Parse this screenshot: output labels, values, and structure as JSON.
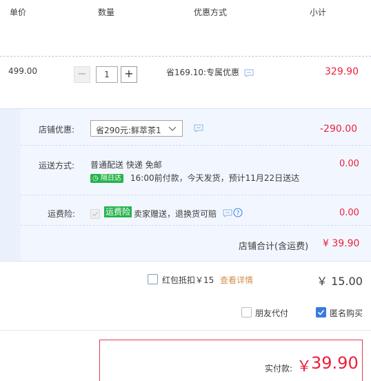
{
  "header": {
    "col_price": "单价",
    "col_qty": "数量",
    "col_promo": "优惠方式",
    "col_subtotal": "小计"
  },
  "item": {
    "price": "499.00",
    "minus": "−",
    "quantity": "1",
    "plus": "+",
    "promo": "省169.10:专属优惠",
    "subtotal": "329.90"
  },
  "shop_discount": {
    "label": "店铺优惠:",
    "selected": "省290元:鲜萃茶1",
    "amount": "-290.00"
  },
  "shipping": {
    "label": "运送方式:",
    "method": "普通配送 快递 免邮",
    "badge": "隔日达",
    "note": "16:00前付款，今天发货，预计11月22日送达",
    "amount": "0.00"
  },
  "insurance": {
    "label": "运费险:",
    "badge": "运费险",
    "text": "卖家赠送，退换货可赔",
    "amount": "0.00"
  },
  "shop_total": {
    "label": "店铺合计(含运费)",
    "amount": "¥ 39.90"
  },
  "red_packet": {
    "label": "红包抵扣￥15",
    "link": "查看详情",
    "amount": "￥ 15.00"
  },
  "options": {
    "friend_pay": "朋友代付",
    "anonymous": "匿名购买",
    "anonymous_checked": true
  },
  "payment": {
    "label": "实付款:",
    "currency": "￥",
    "amount": "39.90"
  },
  "colors": {
    "accent_red": "#ee1e3b",
    "link_orange": "#d58e4a",
    "panel_blue": "#f2f7ff",
    "badge_green": "#27b34b"
  }
}
